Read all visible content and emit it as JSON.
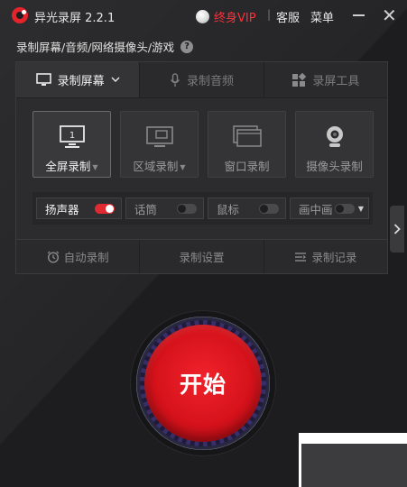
{
  "titlebar": {
    "app_title": "异光录屏 2.2.1",
    "vip_label": "终身VIP",
    "separator": "|",
    "service_label": "客服",
    "menu_label": "菜单",
    "close_glyph": "✕"
  },
  "subtitle": {
    "text": "录制屏幕/音频/网络摄像头/游戏",
    "help_glyph": "?"
  },
  "tabs": [
    {
      "label": "录制屏幕",
      "icon": "monitor-icon",
      "active": true,
      "dropdown": true
    },
    {
      "label": "录制音频",
      "icon": "microphone-icon",
      "active": false
    },
    {
      "label": "录屏工具",
      "icon": "grid-icon",
      "active": false
    }
  ],
  "modes": [
    {
      "label": "全屏录制",
      "icon": "fullscreen-icon",
      "active": true,
      "dropdown": true,
      "badge": "1"
    },
    {
      "label": "区域录制",
      "icon": "region-icon",
      "active": false,
      "dropdown": true
    },
    {
      "label": "窗口录制",
      "icon": "window-icon",
      "active": false
    },
    {
      "label": "摄像头录制",
      "icon": "webcam-icon",
      "active": false
    }
  ],
  "toggles": [
    {
      "label": "扬声器",
      "on": true
    },
    {
      "label": "话筒",
      "on": false
    },
    {
      "label": "鼠标",
      "on": false
    },
    {
      "label": "画中画",
      "on": false,
      "dropdown": true
    }
  ],
  "bottom_bar": [
    {
      "label": "自动录制",
      "icon": "alarm-clock-icon"
    },
    {
      "label": "录制设置",
      "icon": ""
    },
    {
      "label": "录制记录",
      "icon": "list-icon"
    }
  ],
  "start_button": {
    "label": "开始"
  },
  "colors": {
    "accent_red": "#e02a31",
    "background": "#1d1d1f",
    "panel": "#2c2c2e",
    "vip_red": "#ff2f3a"
  }
}
